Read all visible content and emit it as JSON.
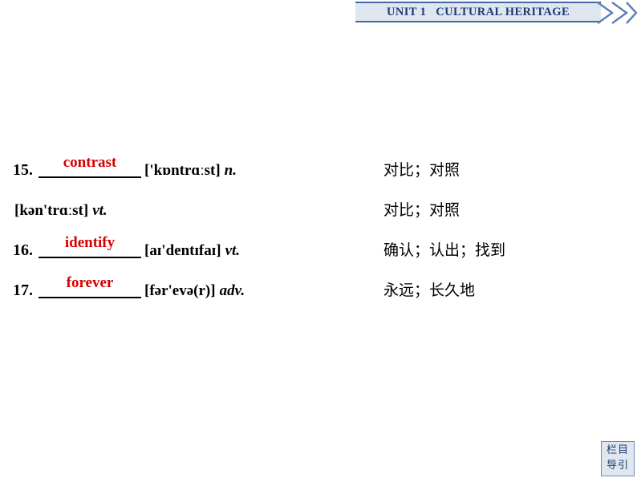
{
  "header": {
    "title": "UNIT 1   CULTURAL HERITAGE",
    "chevron_icon": "double-chevron-right-icon",
    "accent_color": "#3f69a8",
    "text_color": "#1f3c75",
    "fill_color": "#dfe6ef"
  },
  "vocabulary": {
    "answer_color": "#d40000",
    "entries": [
      {
        "number": "15.",
        "answer": "contrast",
        "phonetic": "['kɒntrɑːst]",
        "pos": "n.",
        "chinese": "对比；对照"
      },
      {
        "number": "",
        "answer": "",
        "phonetic": "[kən'trɑːst]",
        "pos": "vt.",
        "chinese": "对比；对照"
      },
      {
        "number": "16.",
        "answer": "identify",
        "phonetic": "[aɪ'dentɪfaɪ]",
        "pos": "vt.",
        "chinese": "确认；认出；找到"
      },
      {
        "number": "17.",
        "answer": "forever",
        "phonetic": "[fər'evə(r)]",
        "pos": "adv.",
        "chinese": "永远；长久地"
      }
    ]
  },
  "nav_button": {
    "line1": "栏目",
    "line2": "导引"
  }
}
